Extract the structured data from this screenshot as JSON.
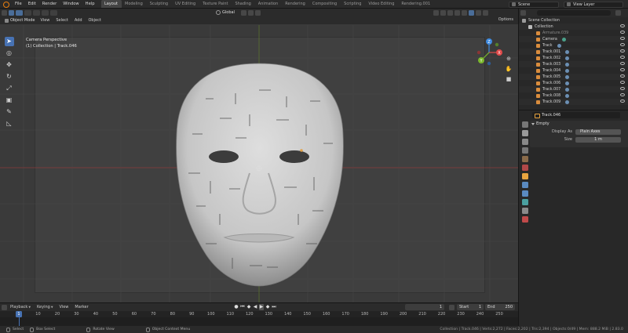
{
  "topbar": {
    "menus": [
      "File",
      "Edit",
      "Render",
      "Window",
      "Help"
    ],
    "workspaces": [
      "Layout",
      "Modeling",
      "Sculpting",
      "UV Editing",
      "Texture Paint",
      "Shading",
      "Animation",
      "Rendering",
      "Compositing",
      "Scripting",
      "Video Editing",
      "Rendering.001"
    ],
    "scene": "Scene",
    "view_layer": "View Layer"
  },
  "viewport": {
    "mode": "Object Mode",
    "menus": [
      "View",
      "Select",
      "Add",
      "Object"
    ],
    "orientation": "Global",
    "options_label": "Options",
    "view_name": "Camera Perspective",
    "view_context": "(1) Collection | Track.046",
    "gizmo_axes": {
      "x": "X",
      "y": "Y",
      "z": "Z"
    },
    "colors": {
      "x_axis": "#e04a4a",
      "y_axis": "#7bb82d",
      "z_axis": "#3d8ae0",
      "accent": "#4772b3"
    }
  },
  "outliner": {
    "rows": [
      {
        "label": "Scene Collection",
        "icon": "scene-collection-icon"
      },
      {
        "label": "Collection",
        "icon": "collection-icon"
      },
      {
        "label": "Armature.039",
        "icon": "armature-icon"
      },
      {
        "label": "Camera",
        "icon": "camera-icon"
      },
      {
        "label": "Track",
        "icon": "empty-icon"
      },
      {
        "label": "Track.001",
        "icon": "empty-icon"
      },
      {
        "label": "Track.002",
        "icon": "empty-icon"
      },
      {
        "label": "Track.003",
        "icon": "empty-icon"
      },
      {
        "label": "Track.004",
        "icon": "empty-icon"
      },
      {
        "label": "Track.005",
        "icon": "empty-icon"
      },
      {
        "label": "Track.006",
        "icon": "empty-icon"
      },
      {
        "label": "Track.007",
        "icon": "empty-icon"
      },
      {
        "label": "Track.008",
        "icon": "empty-icon"
      },
      {
        "label": "Track.009",
        "icon": "empty-icon"
      }
    ]
  },
  "properties": {
    "object_name": "Track.046",
    "panel_title": "Empty",
    "display_as_label": "Display As",
    "display_as_value": "Plain Axes",
    "size_label": "Size",
    "size_value": "1 m"
  },
  "timeline": {
    "menus": [
      "Playback",
      "Keying",
      "View",
      "Marker"
    ],
    "current_frame": "1",
    "current_frame_marker": "1",
    "start_label": "Start",
    "start_value": "1",
    "end_label": "End",
    "end_value": "250",
    "ruler_ticks": [
      "0",
      "10",
      "20",
      "30",
      "40",
      "50",
      "60",
      "70",
      "80",
      "90",
      "100",
      "110",
      "120",
      "130",
      "140",
      "150",
      "160",
      "170",
      "180",
      "190",
      "200",
      "210",
      "220",
      "230",
      "240",
      "250"
    ]
  },
  "statusbar": {
    "left": [
      {
        "label": "Select"
      },
      {
        "label": "Box Select"
      },
      {
        "label": "Rotate View"
      },
      {
        "label": "Object Context Menu"
      }
    ],
    "stats": "Collection | Track.046 | Verts:2,272 | Faces:2,202 | Tris:2,394 | Objects:0/49 | Mem: 888.2 MiB | 2.83.0"
  }
}
